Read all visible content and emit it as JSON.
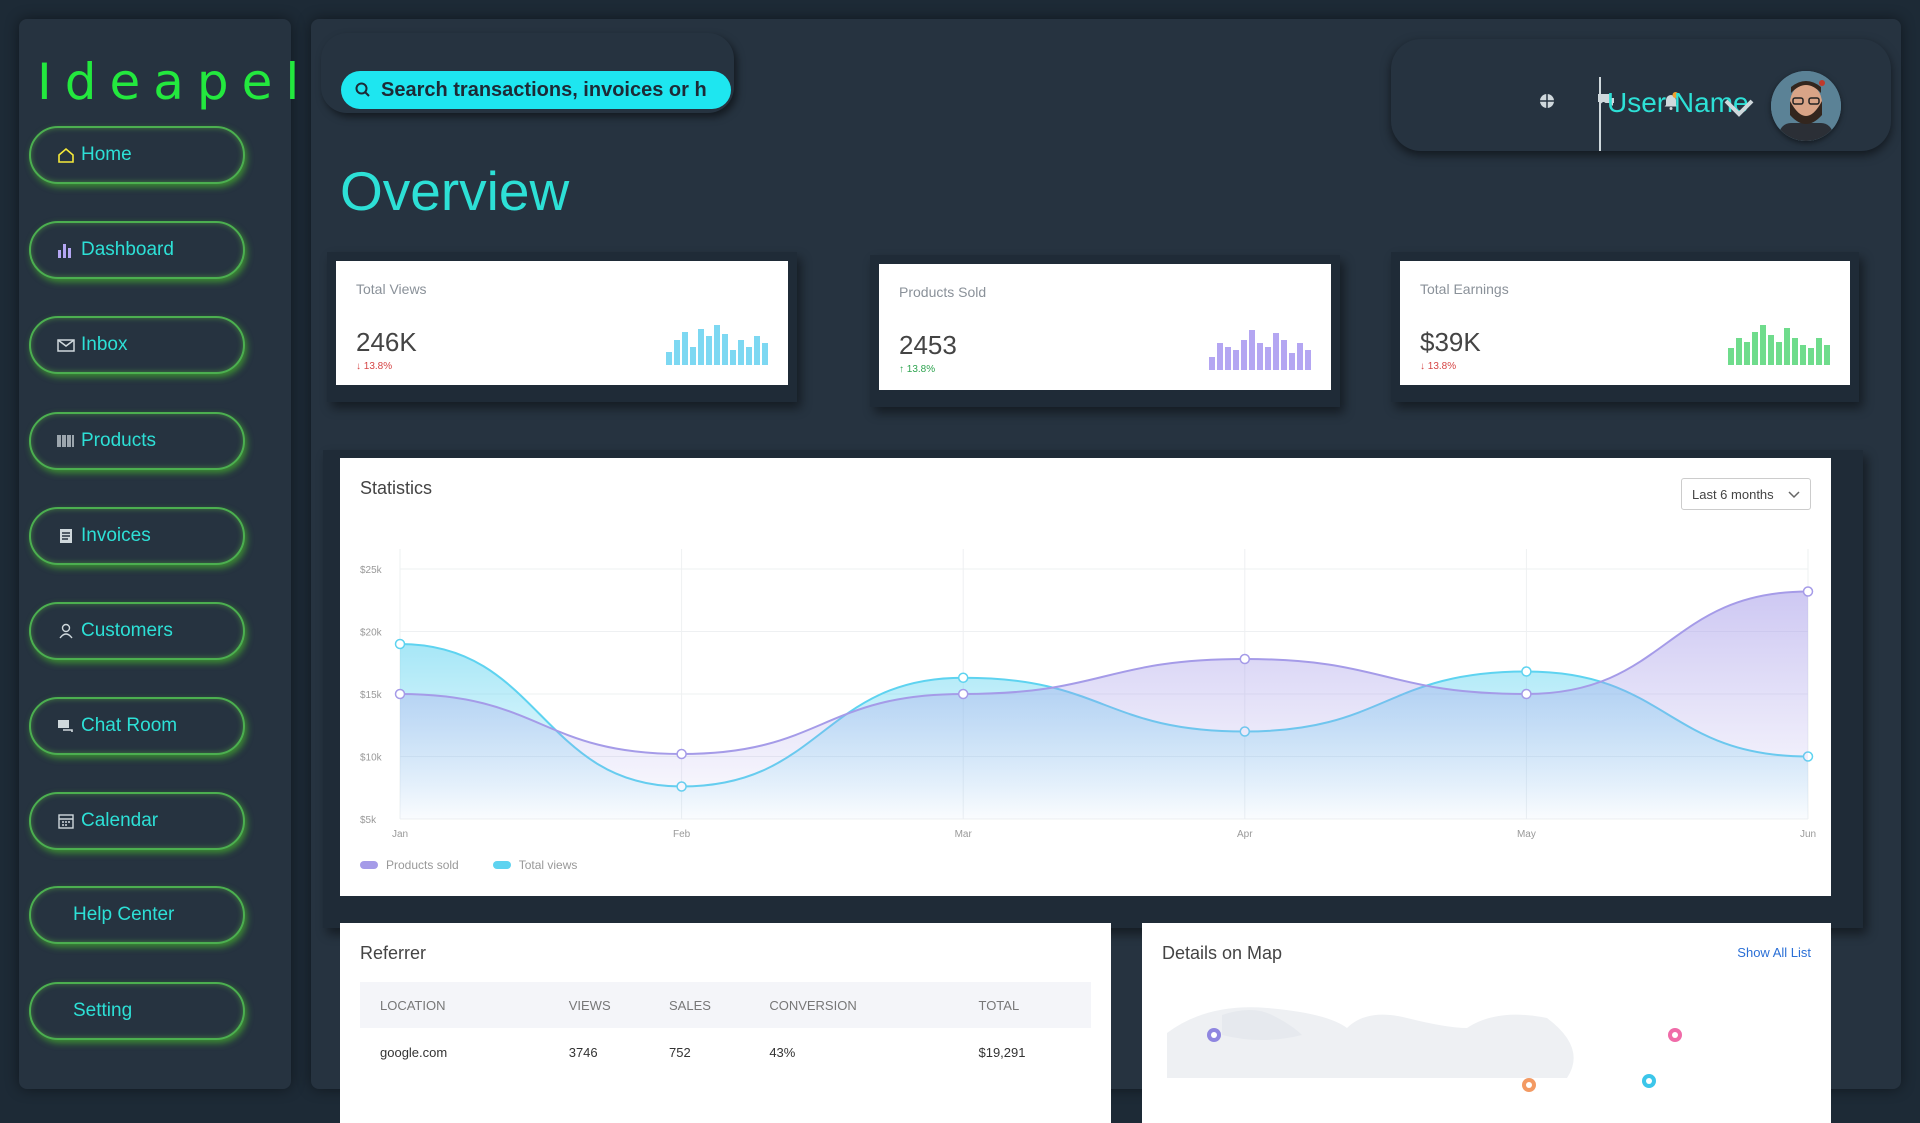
{
  "brand": "Ideapell",
  "sidebar": [
    {
      "label": "Home",
      "icon": "home-icon"
    },
    {
      "label": "Dashboard",
      "icon": "bar-chart-icon"
    },
    {
      "label": "Inbox",
      "icon": "mail-icon"
    },
    {
      "label": "Products",
      "icon": "barcode-icon"
    },
    {
      "label": "Invoices",
      "icon": "invoice-icon"
    },
    {
      "label": "Customers",
      "icon": "user-icon"
    },
    {
      "label": "Chat Room",
      "icon": "chat-icon"
    },
    {
      "label": "Calendar",
      "icon": "calendar-icon"
    },
    {
      "label": "Help Center",
      "icon": ""
    },
    {
      "label": "Setting",
      "icon": ""
    }
  ],
  "search": {
    "placeholder": "Search transactions, invoices or h"
  },
  "header": {
    "user_name": "User Name",
    "icons": [
      "globe-icon",
      "chat-icon",
      "bell-icon",
      "chevron-down-icon"
    ]
  },
  "page_title": "Overview",
  "cards": [
    {
      "label": "Total Views",
      "value": "246K",
      "change": "13.8%",
      "direction": "down",
      "color": "#7dd8f2",
      "bars": [
        7,
        14,
        18,
        10,
        20,
        16,
        22,
        17,
        8,
        14,
        10,
        16,
        12
      ]
    },
    {
      "label": "Products Sold",
      "value": "2453",
      "change": "13.8%",
      "direction": "up",
      "color": "#b4a6f2",
      "bars": [
        8,
        16,
        14,
        12,
        18,
        24,
        16,
        14,
        22,
        18,
        10,
        16,
        12
      ]
    },
    {
      "label": "Total Earnings",
      "value": "$39K",
      "change": "13.8%",
      "direction": "down",
      "color": "#6fdc8c",
      "bars": [
        10,
        16,
        14,
        20,
        24,
        18,
        14,
        22,
        16,
        12,
        10,
        16,
        12
      ]
    }
  ],
  "statistics": {
    "title": "Statistics",
    "range": "Last 6 months",
    "chart_data": {
      "type": "area",
      "categories": [
        "Jan",
        "Feb",
        "Mar",
        "Apr",
        "May",
        "Jun"
      ],
      "ylabels": [
        "$25k",
        "$20k",
        "$15k",
        "$10k",
        "$5k"
      ],
      "ylim": [
        5000,
        25000
      ],
      "series": [
        {
          "name": "Products sold",
          "color": "#a59be8",
          "values": [
            15000,
            10200,
            15000,
            17800,
            15000,
            23200
          ]
        },
        {
          "name": "Total views",
          "color": "#5ed3f0",
          "values": [
            19000,
            7600,
            16300,
            12000,
            16800,
            10000
          ]
        }
      ],
      "legend": "bottom-left"
    }
  },
  "referrer": {
    "title": "Referrer",
    "columns": [
      "LOCATION",
      "VIEWS",
      "SALES",
      "CONVERSION",
      "TOTAL"
    ],
    "rows": [
      [
        "google.com",
        "3746",
        "752",
        "43%",
        "$19,291"
      ]
    ]
  },
  "map": {
    "title": "Details on Map",
    "link": "Show All List"
  }
}
